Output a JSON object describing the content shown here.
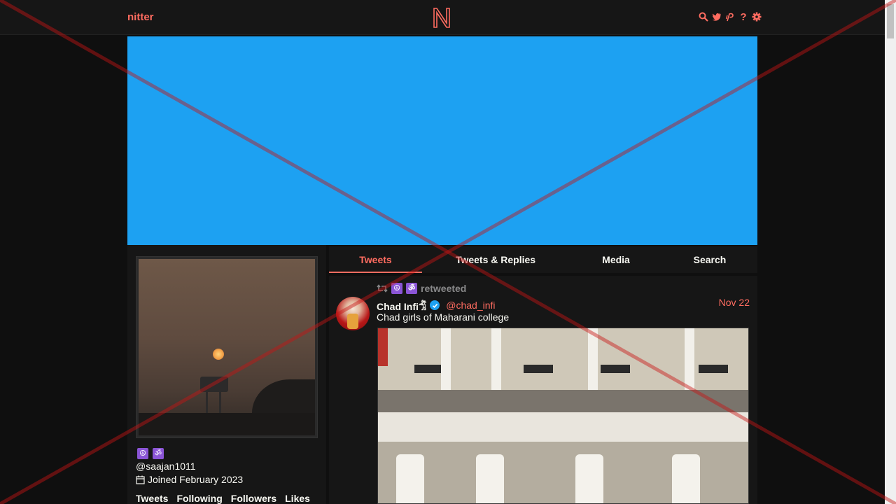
{
  "nav": {
    "brand": "nitter",
    "logo_letter": "N",
    "icons": [
      "search-icon",
      "twitter-bird-icon",
      "rss-icon",
      "help-icon",
      "gear-icon"
    ],
    "help_glyph": "?"
  },
  "colors": {
    "accent": "#ff6c60",
    "banner": "#1da1f2",
    "background": "#0f0f0f",
    "panel": "#161616",
    "badge": "#8b55d6"
  },
  "profile": {
    "badges": [
      "☮",
      "ॐ"
    ],
    "username": "@saajan1011",
    "joined": "Joined February 2023",
    "stats": [
      "Tweets",
      "Following",
      "Followers",
      "Likes"
    ]
  },
  "tabs": [
    {
      "label": "Tweets",
      "active": true
    },
    {
      "label": "Tweets & Replies",
      "active": false
    },
    {
      "label": "Media",
      "active": false
    },
    {
      "label": "Search",
      "active": false
    }
  ],
  "tweet": {
    "retweet_badges": [
      "☮",
      "ॐ"
    ],
    "retweet_label": "retweeted",
    "author_name": "Chad Infi",
    "author_suffix": "𓀦",
    "handle": "@chad_infi",
    "date": "Nov 22",
    "text": "Chad girls of Maharani college"
  }
}
